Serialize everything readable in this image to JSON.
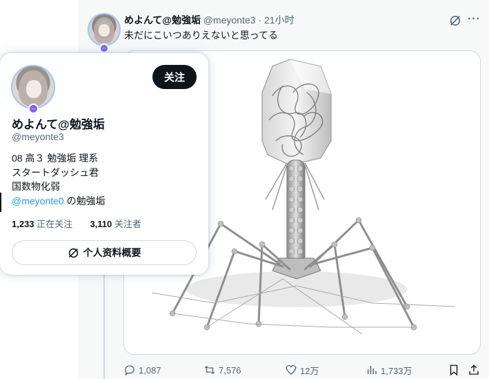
{
  "tweet": {
    "author_name": "めよんて@勉強垢",
    "author_handle": "@meyonte3",
    "separator": " · ",
    "time": "21小时",
    "text": "未だにこいつありえないと思ってる",
    "media_icon": "bacteriophage-3d-render",
    "actions": {
      "reply": {
        "icon": "reply-icon",
        "count": "1,087"
      },
      "retweet": {
        "icon": "retweet-icon",
        "count": "7,576"
      },
      "like": {
        "icon": "heart-icon",
        "count": "12万"
      },
      "views": {
        "icon": "views-chart-icon",
        "count": "1,733万"
      },
      "bookmark": {
        "icon": "bookmark-icon"
      },
      "share": {
        "icon": "share-icon"
      }
    }
  },
  "hovercard": {
    "name": "めよんて@勉強垢",
    "handle": "@meyonte3",
    "follow_label": "关注",
    "bio_lines": [
      "08 高３ 勉強垢 理系",
      "スタートダッシュ君",
      "国数物化弱"
    ],
    "bio_mention": "@meyonte0",
    "bio_mention_suffix": " の勉強垢",
    "following_count": "1,233",
    "following_label": "正在关注",
    "followers_count": "3,110",
    "followers_label": "关注者",
    "profile_summary_label": "个人资料概要",
    "badge_symbol": "–"
  },
  "colors": {
    "accent": "#1d9bf0",
    "text_primary": "#0f1419",
    "text_secondary": "#536471",
    "badge": "#7b61ff",
    "avatar_ring": "#9ec6ff"
  }
}
